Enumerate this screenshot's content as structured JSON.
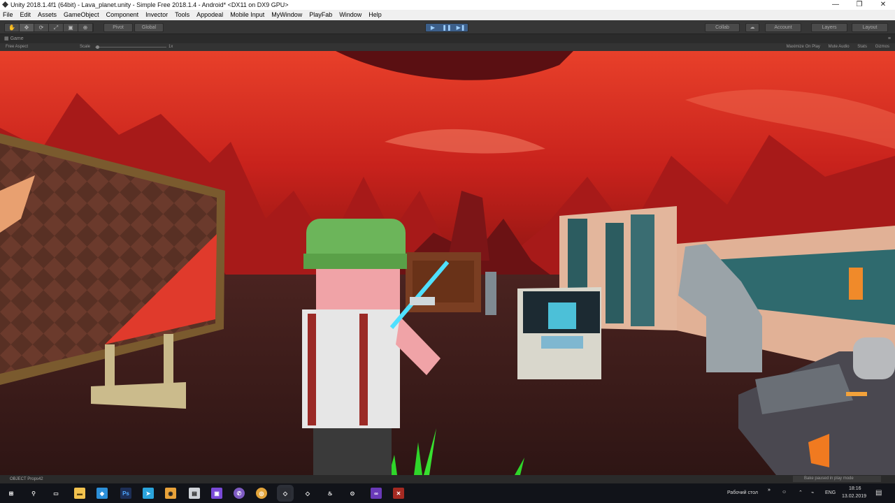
{
  "window": {
    "title": "Unity 2018.1.4f1 (64bit) - Lava_planet.unity - Simple Free 2018.1.4 - Android* <DX11 on DX9 GPU>",
    "controls": [
      "—",
      "❐",
      "✕"
    ]
  },
  "menu": [
    "File",
    "Edit",
    "Assets",
    "GameObject",
    "Component",
    "Invector",
    "Tools",
    "Appodeal",
    "Mobile Input",
    "MyWindow",
    "PlayFab",
    "Window",
    "Help"
  ],
  "toolbar": {
    "tools": [
      "✋",
      "✥",
      "⟳",
      "⤢",
      "▣",
      "⊕"
    ],
    "pivot": "Pivot",
    "global": "Global",
    "play": "▶",
    "pause": "❚❚",
    "step": "▶❚",
    "collab": "Collab",
    "account": "Account",
    "layers": "Layers",
    "layout": "Layout"
  },
  "game_view": {
    "tab": "Game",
    "aspect": "Free Aspect",
    "scale_label": "Scale",
    "scale_value": "1x",
    "maximize_on_play": "Maximize On Play",
    "mute_audio": "Mute Audio",
    "stats": "Stats",
    "gizmos": "Gizmos"
  },
  "status": {
    "selected": "OBJECT Props42",
    "bake": "Bake paused in play mode"
  },
  "taskbar": {
    "desktop": "Рабочий стол",
    "lang": "ENG",
    "time": "18:16",
    "date": "13.02.2019"
  },
  "colors": {
    "sky": "#c8221c",
    "ground": "#3a1c1a",
    "accent_play": "#3c5f8a"
  }
}
